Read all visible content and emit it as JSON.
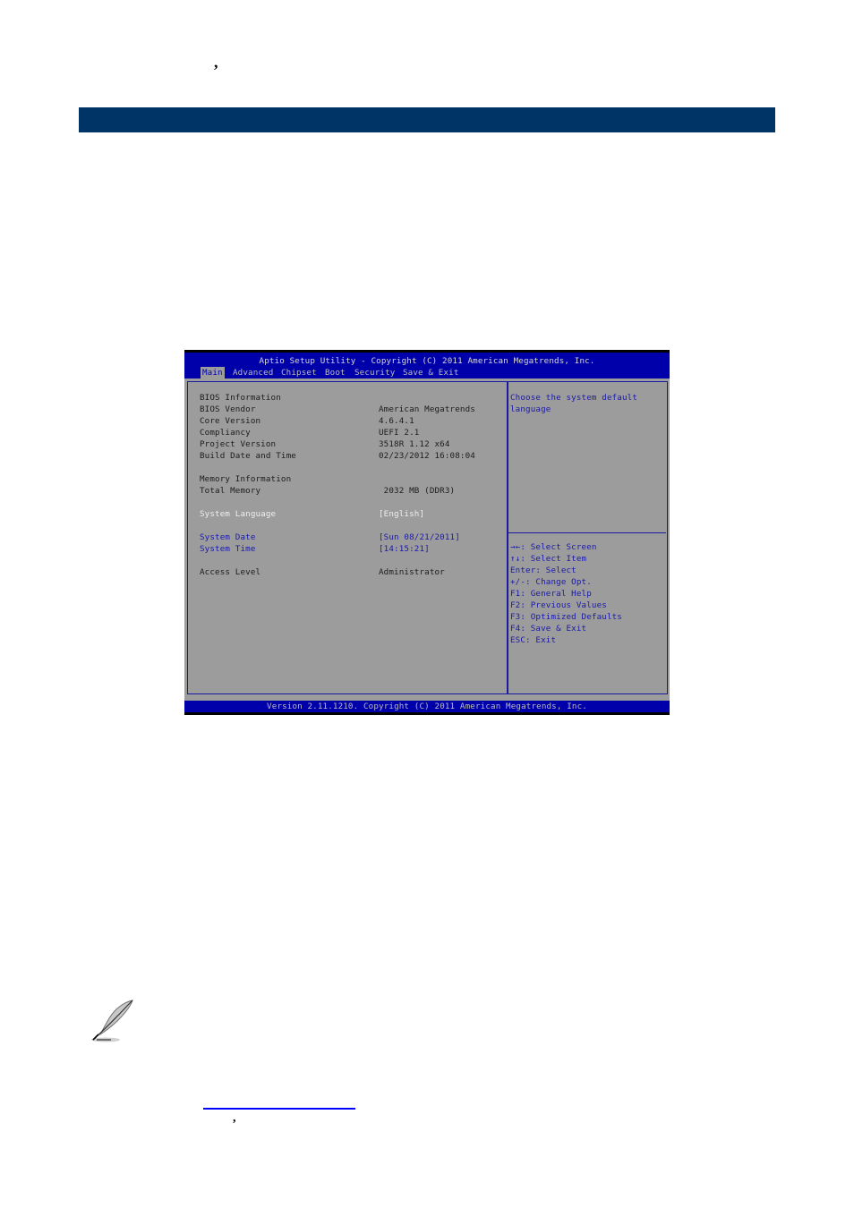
{
  "document": {
    "stray_marks": {
      "top": ",",
      "bottom": ","
    },
    "section_bar_color": "#003366",
    "note_icon": "feather-pen-icon",
    "link_color": "#0000ff"
  },
  "bios": {
    "title": "Aptio Setup Utility - Copyright (C) 2011 American Megatrends, Inc.",
    "menu": [
      {
        "label": "Main",
        "active": true
      },
      {
        "label": "Advanced",
        "active": false
      },
      {
        "label": "Chipset",
        "active": false
      },
      {
        "label": "Boot",
        "active": false
      },
      {
        "label": "Security",
        "active": false
      },
      {
        "label": "Save & Exit",
        "active": false
      }
    ],
    "sections": {
      "bios_info": "BIOS Information",
      "memory_info": "Memory Information"
    },
    "fields": [
      {
        "label": "BIOS Vendor",
        "value": "American Megatrends"
      },
      {
        "label": "Core Version",
        "value": "4.6.4.1"
      },
      {
        "label": "Compliancy",
        "value": "UEFI 2.1"
      },
      {
        "label": "Project Version",
        "value": "3518R 1.12 x64"
      },
      {
        "label": "Build Date and Time",
        "value": "02/23/2012 16:08:04"
      },
      {
        "label": "Total Memory",
        "value": " 2032 MB (DDR3)"
      },
      {
        "label": "System Language",
        "value": "[English]"
      },
      {
        "label": "System Date",
        "value": "[Sun 08/21/2011]"
      },
      {
        "label": "System Time",
        "value": "[14:15:21]"
      },
      {
        "label": "Access Level",
        "value": "Administrator"
      }
    ],
    "help": {
      "description": [
        "Choose the system default",
        "language"
      ],
      "keys": [
        "→←: Select Screen",
        "↑↓: Select Item",
        "Enter: Select",
        "+/-: Change Opt.",
        "F1: General Help",
        "F2: Previous Values",
        "F3: Optimized Defaults",
        "F4: Save & Exit",
        "ESC: Exit"
      ]
    },
    "footer": "Version 2.11.1210. Copyright (C) 2011 American Megatrends, Inc.",
    "colors": {
      "frame_blue": "#0000aa",
      "panel_gray": "#9c9c9c",
      "selectable_text": "#1a1aa8",
      "highlight_text": "#efefef"
    }
  }
}
